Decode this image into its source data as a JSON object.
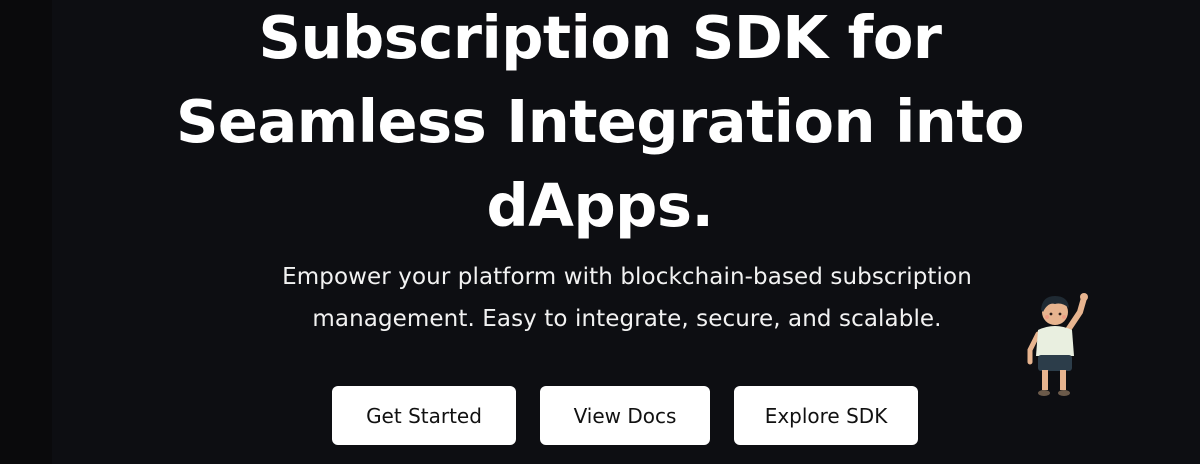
{
  "hero": {
    "headline_lines": [
      "Subscription SDK for",
      "Seamless Integration into",
      "dApps."
    ],
    "subtitle_lines": [
      "Empower your platform with blockchain-based subscription",
      "management. Easy to integrate, secure, and scalable."
    ]
  },
  "buttons": {
    "get_started": "Get Started",
    "view_docs": "View Docs",
    "explore_sdk": "Explore SDK"
  },
  "mascot": {
    "icon": "waving-boy-illustration"
  },
  "colors": {
    "background": "#0d0e12",
    "text": "#ffffff",
    "button_bg": "#ffffff",
    "button_text": "#111111"
  }
}
